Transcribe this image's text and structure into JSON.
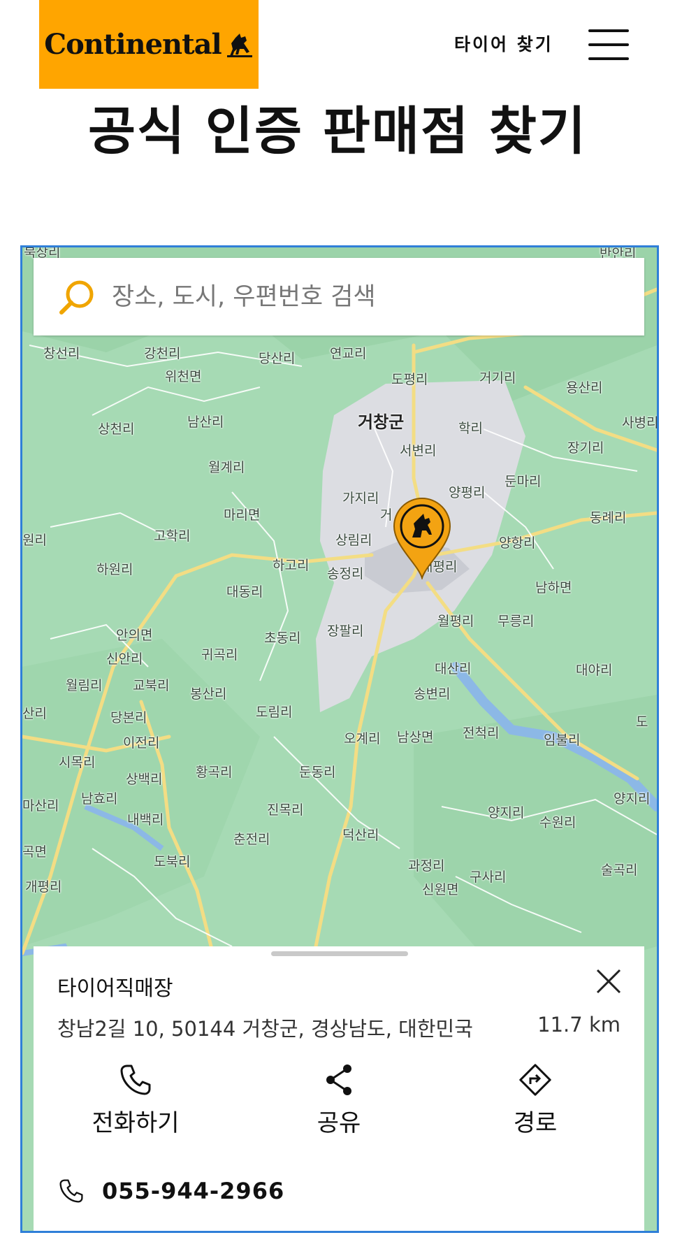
{
  "header": {
    "brand": "Continental",
    "nav_link": "타이어 찾기",
    "menu_icon": "hamburger-menu-icon",
    "brand_color": "#ffa500"
  },
  "page_title": "공식 인증 판매점 찾기",
  "search": {
    "placeholder": "장소, 도시, 우편번호 검색",
    "value": "",
    "icon": "search-icon",
    "icon_color": "#f0a500"
  },
  "map": {
    "places": [
      {
        "name": "북상리"
      },
      {
        "name": "반안리"
      },
      {
        "name": "창선리"
      },
      {
        "name": "강천리"
      },
      {
        "name": "위천면"
      },
      {
        "name": "당산리"
      },
      {
        "name": "연교리"
      },
      {
        "name": "도평리"
      },
      {
        "name": "거기리"
      },
      {
        "name": "용산리"
      },
      {
        "name": "상천리"
      },
      {
        "name": "남산리"
      },
      {
        "name": "거창군"
      },
      {
        "name": "학리"
      },
      {
        "name": "서변리"
      },
      {
        "name": "사병리"
      },
      {
        "name": "장기리"
      },
      {
        "name": "월계리"
      },
      {
        "name": "둔마리"
      },
      {
        "name": "가지리"
      },
      {
        "name": "양평리"
      },
      {
        "name": "마리면"
      },
      {
        "name": "거"
      },
      {
        "name": "동례리"
      },
      {
        "name": "원리"
      },
      {
        "name": "고학리"
      },
      {
        "name": "상림리"
      },
      {
        "name": "양항리"
      },
      {
        "name": "하원리"
      },
      {
        "name": "하고리"
      },
      {
        "name": "송정리"
      },
      {
        "name": "대평리"
      },
      {
        "name": "대동리"
      },
      {
        "name": "남하면"
      },
      {
        "name": "안의면"
      },
      {
        "name": "장팔리"
      },
      {
        "name": "초동리"
      },
      {
        "name": "월평리"
      },
      {
        "name": "무릉리"
      },
      {
        "name": "신안리"
      },
      {
        "name": "귀곡리"
      },
      {
        "name": "대산리"
      },
      {
        "name": "대야리"
      },
      {
        "name": "월림리"
      },
      {
        "name": "교북리"
      },
      {
        "name": "봉산리"
      },
      {
        "name": "송변리"
      },
      {
        "name": "산리"
      },
      {
        "name": "당본리"
      },
      {
        "name": "도림리"
      },
      {
        "name": "도"
      },
      {
        "name": "전척리"
      },
      {
        "name": "이전리"
      },
      {
        "name": "오계리"
      },
      {
        "name": "남상면"
      },
      {
        "name": "임불리"
      },
      {
        "name": "시목리"
      },
      {
        "name": "황곡리"
      },
      {
        "name": "둔동리"
      },
      {
        "name": "상백리"
      },
      {
        "name": "남효리"
      },
      {
        "name": "양지리"
      },
      {
        "name": "마산리"
      },
      {
        "name": "진목리"
      },
      {
        "name": "양지리"
      },
      {
        "name": "내백리"
      },
      {
        "name": "수원리"
      },
      {
        "name": "곡면"
      },
      {
        "name": "춘전리"
      },
      {
        "name": "덕산리"
      },
      {
        "name": "도북리"
      },
      {
        "name": "과정리"
      },
      {
        "name": "구사리"
      },
      {
        "name": "술곡리"
      },
      {
        "name": "개평리"
      },
      {
        "name": "신원면"
      }
    ],
    "marker": {
      "label": "CONTINENTAL SINCE 1871",
      "color": "#f3a312"
    }
  },
  "dealer": {
    "name": "타이어직매장",
    "address": "창남2길 10, 50144 거창군, 경상남도, 대한민국",
    "distance": "11.7 km",
    "actions": [
      {
        "label": "전화하기",
        "icon": "phone-icon"
      },
      {
        "label": "공유",
        "icon": "share-icon"
      },
      {
        "label": "경로",
        "icon": "directions-icon"
      }
    ],
    "phone": "055-944-2966"
  }
}
